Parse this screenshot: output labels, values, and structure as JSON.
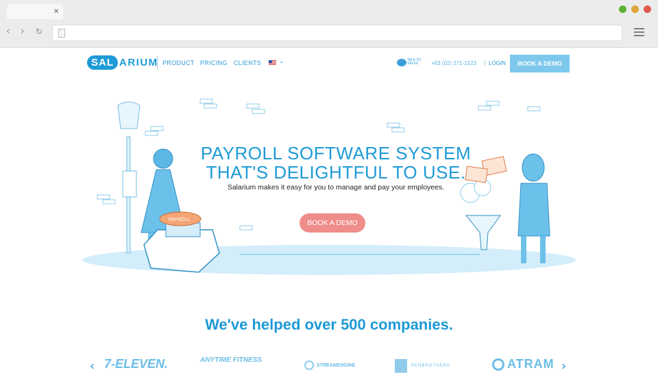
{
  "browser": {
    "tab_close": "×",
    "back": "‹",
    "forward": "›",
    "reload": "↻",
    "traffic_colors": [
      "#5fb037",
      "#e0a43a",
      "#e05a4f"
    ]
  },
  "header": {
    "logo_left": "SAL",
    "logo_right": "ARIUM",
    "nav": {
      "product": "PRODUCT",
      "pricing": "PRICING",
      "clients": "CLIENTS",
      "caret": "⌄"
    },
    "talk_to_sales": "TALK TO SALES",
    "phone": "+63 (02) 271-1523",
    "separator": "|",
    "login": "LOGIN",
    "book_demo": "BOOK A DEMO"
  },
  "hero": {
    "title_line1": "PAYROLL SOFTWARE SYSTEM",
    "title_line2": "THAT'S DELIGHTFUL TO USE.",
    "subtitle": "Salarium makes it easy for you to manage and pay your employees.",
    "button": "BOOK A DEMO",
    "payroll_label": "PAYROLL"
  },
  "companies": {
    "title": "We've helped over 500 companies.",
    "prev": "‹",
    "next": "›",
    "clients": [
      {
        "name": "7-ELEVEN."
      },
      {
        "name": "ANYTIME FITNESS"
      },
      {
        "name": "STREAMENGINE"
      },
      {
        "name": "PENBROTHERS"
      },
      {
        "name": "ATRAM"
      }
    ]
  },
  "colors": {
    "brand_blue": "#1e9ad6",
    "light_blue": "#7dc8ec",
    "cta_pink": "#ee8d8a"
  }
}
